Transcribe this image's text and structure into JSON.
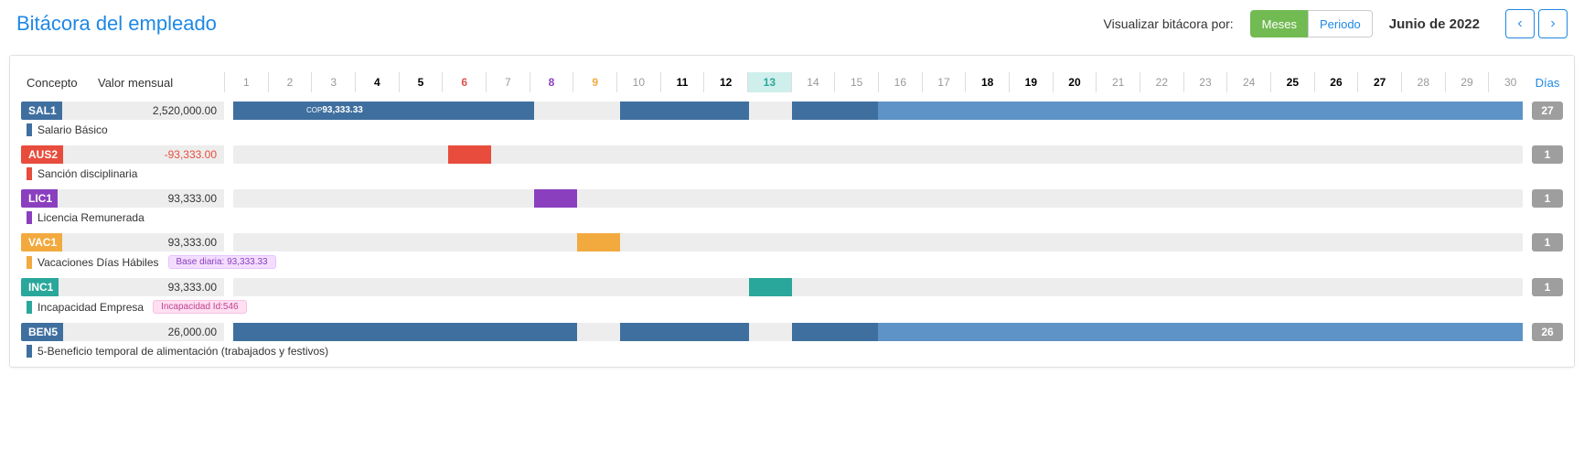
{
  "header": {
    "title": "Bitácora del empleado",
    "view_by_label": "Visualizar bitácora por:",
    "btn_months": "Meses",
    "btn_period": "Periodo",
    "period": "Junio de 2022"
  },
  "columns": {
    "concept": "Concepto",
    "monthly": "Valor mensual",
    "days": "Días"
  },
  "calendar": {
    "days": [
      {
        "n": 1
      },
      {
        "n": 2
      },
      {
        "n": 3
      },
      {
        "n": 4,
        "bold": true
      },
      {
        "n": 5,
        "bold": true
      },
      {
        "n": 6,
        "sun": true
      },
      {
        "n": 7
      },
      {
        "n": 8,
        "sat": true
      },
      {
        "n": 9,
        "sat": true,
        "amber": true
      },
      {
        "n": 10
      },
      {
        "n": 11,
        "bold": true
      },
      {
        "n": 12,
        "bold": true
      },
      {
        "n": 13,
        "hi": true,
        "teal": true
      },
      {
        "n": 14
      },
      {
        "n": 15
      },
      {
        "n": 16
      },
      {
        "n": 17
      },
      {
        "n": 18,
        "bold": true
      },
      {
        "n": 19,
        "bold": true
      },
      {
        "n": 20,
        "bold": true
      },
      {
        "n": 21
      },
      {
        "n": 22
      },
      {
        "n": 23
      },
      {
        "n": 24
      },
      {
        "n": 25,
        "bold": true
      },
      {
        "n": 26,
        "bold": true
      },
      {
        "n": 27,
        "bold": true
      },
      {
        "n": 28
      },
      {
        "n": 29
      },
      {
        "n": 30
      }
    ]
  },
  "rows": [
    {
      "code": "SAL1",
      "value": "2,520,000.00",
      "days": "27",
      "desc": "Salario Básico",
      "color": "steel",
      "bar": [
        {
          "from": 1,
          "to": 7,
          "shade": "bg-steel",
          "label": "COP93,333.33",
          "labelPrefix": "COP",
          "labelVal": "93,333.33"
        },
        {
          "from": 10,
          "to": 12,
          "shade": "bg-steel"
        },
        {
          "from": 14,
          "to": 15,
          "shade": "bg-steel"
        },
        {
          "from": 16,
          "to": 30,
          "shade": "bg-steel-l"
        }
      ]
    },
    {
      "code": "AUS2",
      "value": "-93,333.00",
      "neg": true,
      "days": "1",
      "desc": "Sanción disciplinaria",
      "color": "red",
      "bar": [
        {
          "from": 6,
          "to": 6,
          "shade": "bg-red"
        }
      ]
    },
    {
      "code": "LIC1",
      "value": "93,333.00",
      "days": "1",
      "desc": "Licencia Remunerada",
      "color": "purple",
      "bar": [
        {
          "from": 8,
          "to": 8,
          "shade": "bg-purple"
        }
      ]
    },
    {
      "code": "VAC1",
      "value": "93,333.00",
      "days": "1",
      "desc": "Vacaciones Días Hábiles",
      "color": "amber",
      "pill": {
        "style": "purple",
        "text": "Base diaria: 93,333.33"
      },
      "bar": [
        {
          "from": 9,
          "to": 9,
          "shade": "bg-amber"
        }
      ]
    },
    {
      "code": "INC1",
      "value": "93,333.00",
      "days": "1",
      "desc": "Incapacidad Empresa",
      "color": "teal",
      "pill": {
        "style": "pink",
        "text": "Incapacidad Id:546"
      },
      "bar": [
        {
          "from": 13,
          "to": 13,
          "shade": "bg-teal"
        }
      ]
    },
    {
      "code": "BEN5",
      "value": "26,000.00",
      "days": "26",
      "desc": "5-Beneficio temporal de alimentación (trabajados y festivos)",
      "color": "steel",
      "bar": [
        {
          "from": 1,
          "to": 7,
          "shade": "bg-steel"
        },
        {
          "from": 8,
          "to": 8,
          "shade": "bg-steel"
        },
        {
          "from": 10,
          "to": 12,
          "shade": "bg-steel"
        },
        {
          "from": 14,
          "to": 15,
          "shade": "bg-steel"
        },
        {
          "from": 16,
          "to": 30,
          "shade": "bg-steel-l"
        }
      ]
    }
  ]
}
